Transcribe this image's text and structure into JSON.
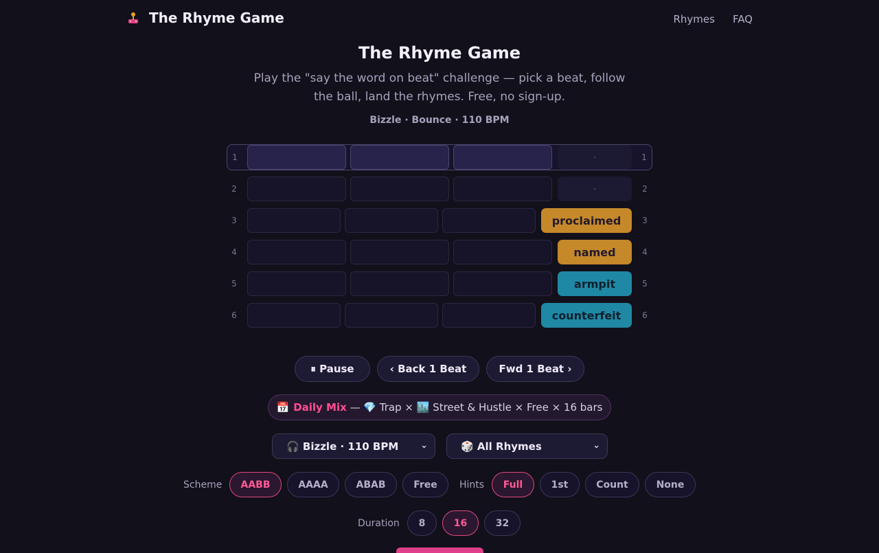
{
  "header": {
    "brand": "The Rhyme Game",
    "nav": [
      "Rhymes",
      "FAQ"
    ]
  },
  "hero": {
    "title": "The Rhyme Game",
    "subtitle": "Play the \"say the word on beat\" challenge — pick a beat, follow the ball, land the rhymes. Free, no sign-up.",
    "beat_info": "Bizzle · Bounce · 110 BPM"
  },
  "board": {
    "rows": [
      {
        "num": "1",
        "word": ""
      },
      {
        "num": "2",
        "word": ""
      },
      {
        "num": "3",
        "word": "proclaimed"
      },
      {
        "num": "4",
        "word": "named"
      },
      {
        "num": "5",
        "word": "armpit"
      },
      {
        "num": "6",
        "word": "counterfeit"
      }
    ]
  },
  "controls": {
    "pause": "⏸ Pause",
    "back": "‹ Back 1 Beat",
    "fwd": "Fwd 1 Beat ›"
  },
  "daily_mix": {
    "icon": "📅",
    "label": "Daily Mix",
    "details": " — 💎 Trap × 🏙️ Street & Hustle × Free × 16 bars"
  },
  "selects": {
    "beat": "🎧 Bizzle · 110 BPM",
    "rhymes": "🎲 All Rhymes"
  },
  "scheme": {
    "label": "Scheme",
    "options": [
      "AABB",
      "AAAA",
      "ABAB",
      "Free"
    ],
    "selected": "AABB"
  },
  "hints": {
    "label": "Hints",
    "options": [
      "Full",
      "1st",
      "Count",
      "None"
    ],
    "selected": "Full"
  },
  "duration": {
    "label": "Duration",
    "options": [
      "8",
      "16",
      "32"
    ],
    "selected": "16"
  },
  "colors": {
    "accent": "#ff4f93",
    "gold": "#c5892a",
    "teal": "#1f89a5",
    "background": "#12101a"
  }
}
